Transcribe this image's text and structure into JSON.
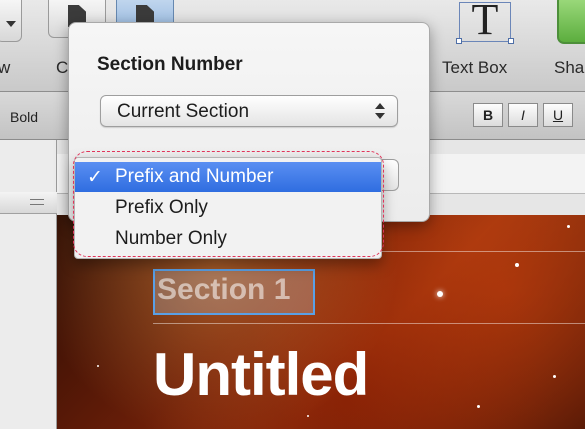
{
  "toolbar": {
    "left_label": "w",
    "c_label": "C",
    "textbox_label": "Text Box",
    "shape_label": "Sha"
  },
  "format_bar": {
    "bold_label": "Bold",
    "style_buttons": [
      "B",
      "I",
      "U"
    ]
  },
  "popover": {
    "title": "Section Number",
    "select_value": "Current Section"
  },
  "menu": {
    "checkmark": "✓",
    "items": [
      {
        "label": "Prefix and Number",
        "selected": true
      },
      {
        "label": "Prefix Only",
        "selected": false
      },
      {
        "label": "Number Only",
        "selected": false
      }
    ]
  },
  "slide": {
    "section_title": "Section 1",
    "title": "Untitled"
  },
  "colors": {
    "menu_highlight": "#2f6de0",
    "callout_ring": "#e0345a",
    "selection_border": "#5aa0e6"
  }
}
